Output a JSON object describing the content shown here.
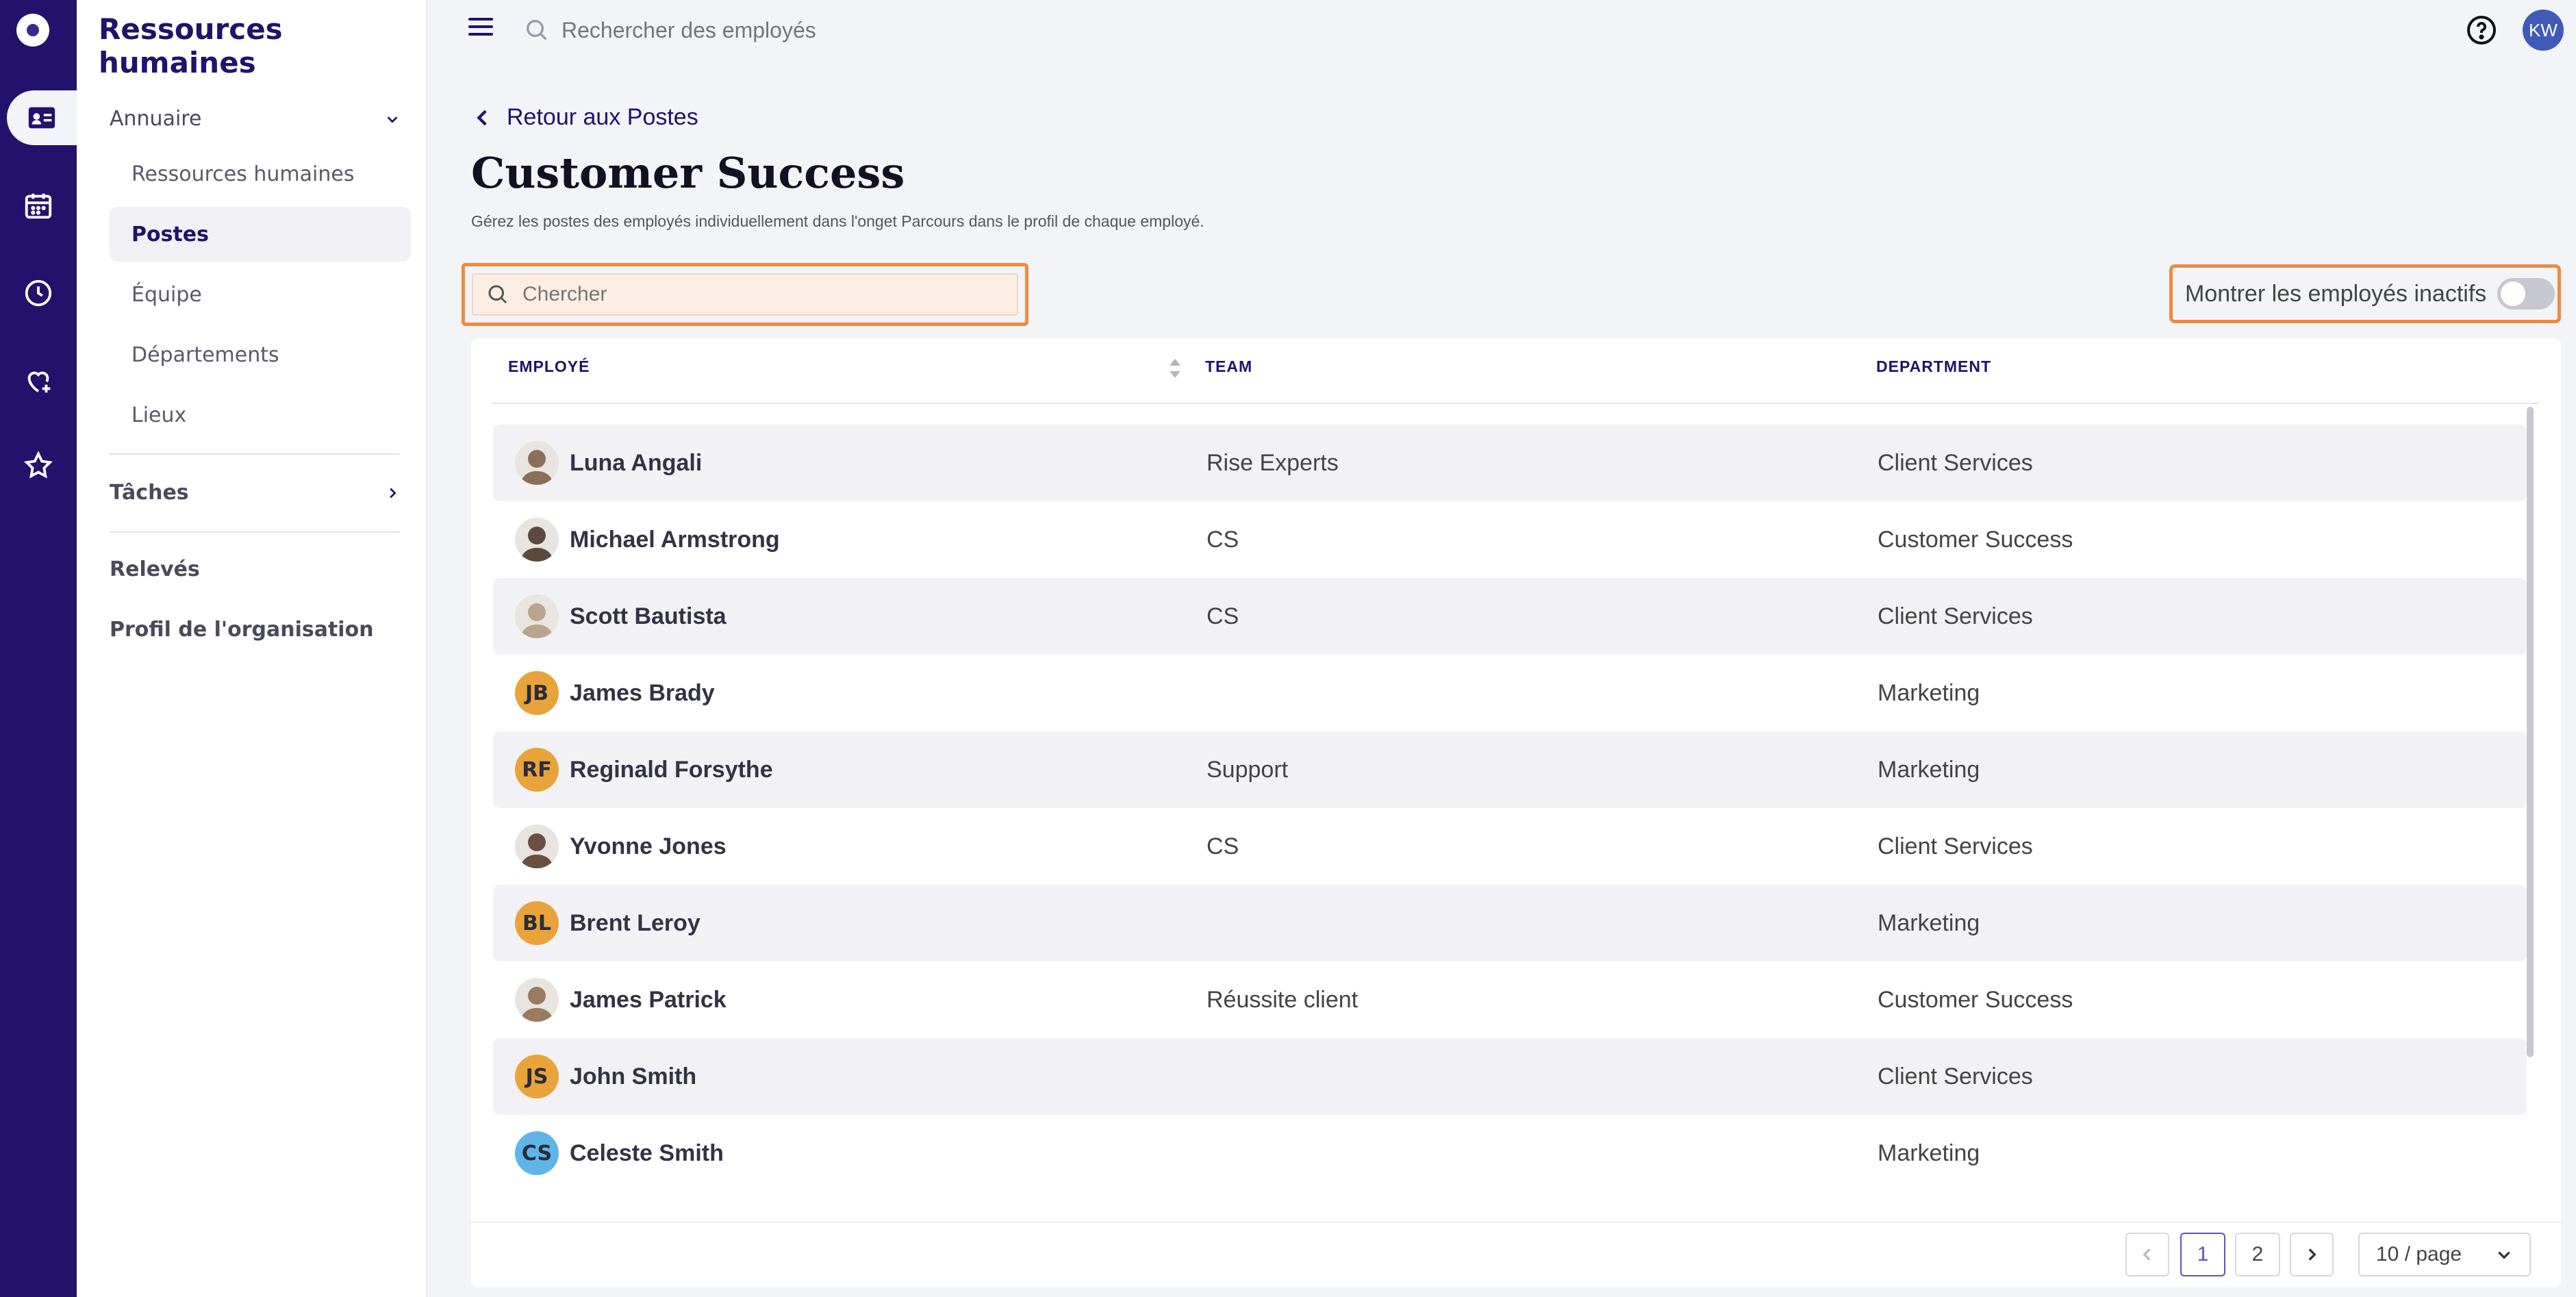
{
  "app": {
    "section_title": "Ressources humaines"
  },
  "topbar": {
    "search_placeholder": "Rechercher des employés",
    "user_initials": "KW"
  },
  "sidebar": {
    "groups": [
      {
        "label": "Annuaire",
        "items": [
          "Ressources humaines",
          "Postes",
          "Équipe",
          "Départements",
          "Lieux"
        ],
        "active": "Postes"
      },
      {
        "label": "Tâches"
      }
    ],
    "links": [
      "Relevés",
      "Profil de l'organisation"
    ]
  },
  "page": {
    "back_label": "Retour aux Postes",
    "title": "Customer Success",
    "subtitle": "Gérez les postes des employés individuellement dans l'onget Parcours dans le profil de chaque employé.",
    "search_placeholder": "Chercher",
    "inactive_toggle_label": "Montrer les employés inactifs",
    "inactive_toggle_on": false
  },
  "table": {
    "headers": [
      "EMPLOYÉ",
      "TEAM",
      "DEPARTMENT"
    ],
    "rows": [
      {
        "name": "Luna Angali",
        "team": "Rise Experts",
        "department": "Client Services",
        "avatar": "photo"
      },
      {
        "name": "Michael Armstrong",
        "team": "CS",
        "department": "Customer Success",
        "avatar": "photo"
      },
      {
        "name": "Scott Bautista",
        "team": "CS",
        "department": "Client Services",
        "avatar": "photo"
      },
      {
        "name": "James Brady",
        "team": "",
        "department": "Marketing",
        "avatar": "JB"
      },
      {
        "name": "Reginald Forsythe",
        "team": "Support",
        "department": "Marketing",
        "avatar": "RF"
      },
      {
        "name": "Yvonne Jones",
        "team": "CS",
        "department": "Client Services",
        "avatar": "photo"
      },
      {
        "name": "Brent Leroy",
        "team": "",
        "department": "Marketing",
        "avatar": "BL"
      },
      {
        "name": "James Patrick",
        "team": "Réussite client",
        "department": "Customer Success",
        "avatar": "photo"
      },
      {
        "name": "John Smith",
        "team": "",
        "department": "Client Services",
        "avatar": "JS"
      },
      {
        "name": "Celeste Smith",
        "team": "",
        "department": "Marketing",
        "avatar": "CS"
      }
    ]
  },
  "pagination": {
    "pages": [
      "1",
      "2"
    ],
    "current": "1",
    "page_size": "10 / page"
  },
  "colors": {
    "brand": "#22126b",
    "highlight": "#f08a3c",
    "avatar_orange": "#e8a33a",
    "avatar_blue": "#5fb6e6"
  }
}
